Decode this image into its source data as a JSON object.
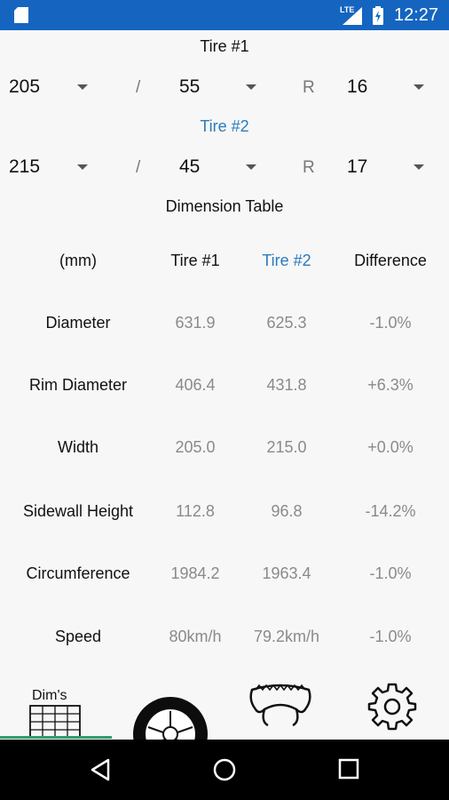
{
  "status_bar": {
    "time": "12:27",
    "network_label": "LTE"
  },
  "tire1": {
    "title": "Tire #1",
    "width": "205",
    "aspect": "55",
    "rim": "16"
  },
  "tire2": {
    "title": "Tire #2",
    "width": "215",
    "aspect": "45",
    "rim": "17"
  },
  "separators": {
    "slash": "/",
    "r": "R"
  },
  "dimension_table": {
    "title": "Dimension Table",
    "headers": [
      "(mm)",
      "Tire #1",
      "Tire #2",
      "Difference"
    ],
    "rows": [
      [
        "Diameter",
        "631.9",
        "625.3",
        "-1.0%"
      ],
      [
        "Rim Diameter",
        "406.4",
        "431.8",
        "+6.3%"
      ],
      [
        "Width",
        "205.0",
        "215.0",
        "+0.0%"
      ],
      [
        "Sidewall Height",
        "112.8",
        "96.8",
        "-14.2%"
      ],
      [
        "Circumference",
        "1984.2",
        "1963.4",
        "-1.0%"
      ],
      [
        "Speed",
        "80km/h",
        "79.2km/h",
        "-1.0%"
      ]
    ]
  },
  "tabs": [
    {
      "icon": "dims-table-icon",
      "label": "Dim's"
    },
    {
      "icon": "wheel-icon"
    },
    {
      "icon": "tire-profile-icon"
    },
    {
      "icon": "settings-gear-icon"
    }
  ],
  "colors": {
    "status_bar": "#1565c0",
    "accent": "#2a7bbf",
    "muted": "#8a8a8a",
    "tab_indicator": "#2e9e6b"
  }
}
